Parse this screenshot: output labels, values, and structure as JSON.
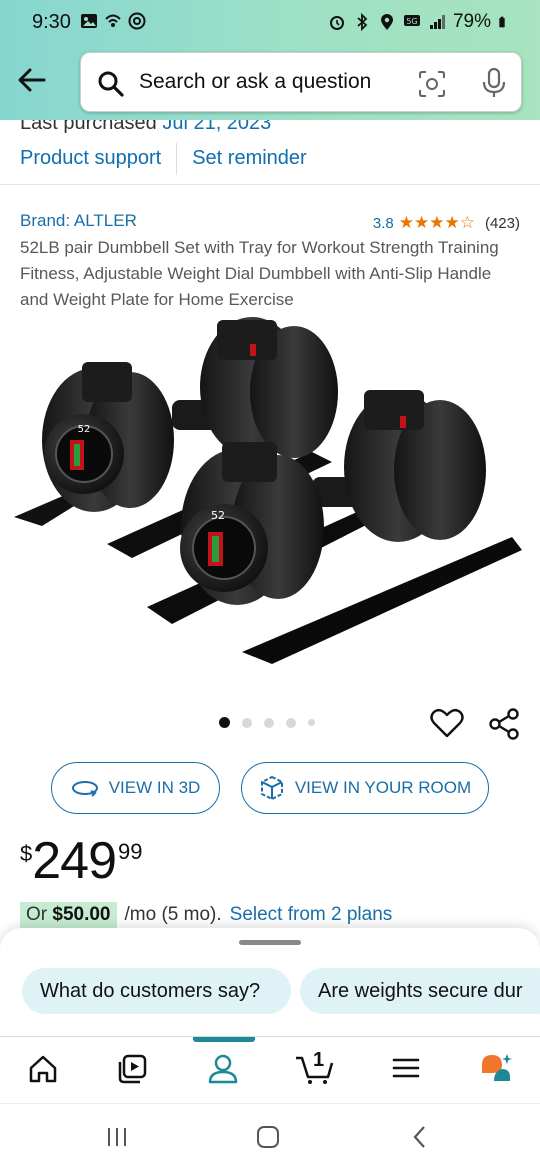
{
  "status_bar": {
    "time": "9:30",
    "battery": "79%",
    "left_icons": [
      "image-icon",
      "wifi-calling-icon",
      "nfc-icon"
    ],
    "right_icons": [
      "alarm-icon",
      "bluetooth-icon",
      "location-icon",
      "5g-icon",
      "signal-icon",
      "battery-icon"
    ]
  },
  "header": {
    "search_placeholder": "Search or ask a question"
  },
  "purchase": {
    "last_purchased_label": "Last purchased",
    "last_purchased_date": "Jul 21, 2023"
  },
  "links": {
    "support": "Product support",
    "reminder": "Set reminder"
  },
  "product": {
    "brand": "Brand: ALTLER",
    "rating": "3.8",
    "stars": "★★★★☆",
    "review_count": "(423)",
    "title": "52LB pair Dumbbell Set with Tray for Workout Strength Training Fitness, Adjustable Weight Dial Dumbbell with Anti-Slip Handle and Weight Plate for Home Exercise",
    "image_count": 5,
    "active_image": 1,
    "dial_label": "52"
  },
  "actions": {
    "view_3d": "VIEW IN 3D",
    "view_room": "VIEW IN YOUR ROOM"
  },
  "price": {
    "symbol": "$",
    "whole": "249",
    "fraction": "99"
  },
  "financing": {
    "prefix": "Or",
    "amount": "$50.00",
    "term": "/mo (5 mo).",
    "select": "Select from 2 plans"
  },
  "suggestions": [
    "What do customers say?",
    "Are weights secure dur"
  ],
  "bottom_nav": {
    "items": [
      "home",
      "video",
      "account",
      "cart",
      "menu",
      "rufus"
    ],
    "cart_count": "1",
    "active": "account"
  },
  "colors": {
    "header_gradient_start": "#86d6d0",
    "header_gradient_end": "#a7e4bf",
    "link": "#1a6ea8",
    "star": "#e77600",
    "emi_bg": "#c5ecd2",
    "chip_bg": "#dff3f6",
    "nav_accent": "#1b8a96"
  }
}
